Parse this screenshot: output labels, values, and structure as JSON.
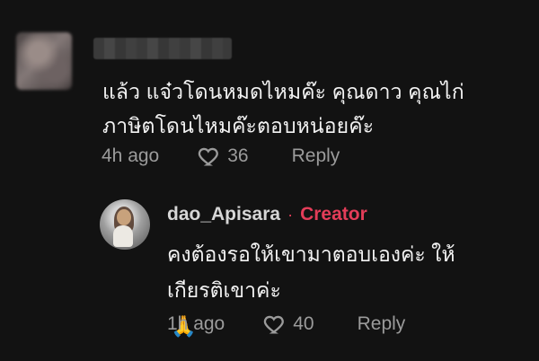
{
  "comment": {
    "text_line_1": "แล้ว แจ๋วโดนหมดไหมค๊ะ คุณดาว คุณไก่",
    "text_line_2": "ภาษิตโดนไหมค๊ะตอบหน่อยค๊ะ",
    "time": "4h ago",
    "likes": "36",
    "reply_label": "Reply"
  },
  "reply": {
    "username": "dao_Apisara",
    "separator": "·",
    "creator_label": "Creator",
    "text_line_1": "คงต้องรอให้เขามาตอบเองค่ะ ให้",
    "text_line_2": "เกียรติเขาค่ะ",
    "emoji": "🙏",
    "time": "1h ago",
    "likes": "40",
    "reply_label": "Reply"
  },
  "icons": {
    "like": "heart-icon",
    "emoji": "praying-hands-icon"
  },
  "colors": {
    "background": "#121212",
    "creator": "#e43d59",
    "muted": "#9b9b9b",
    "text": "#f2f2f2"
  }
}
